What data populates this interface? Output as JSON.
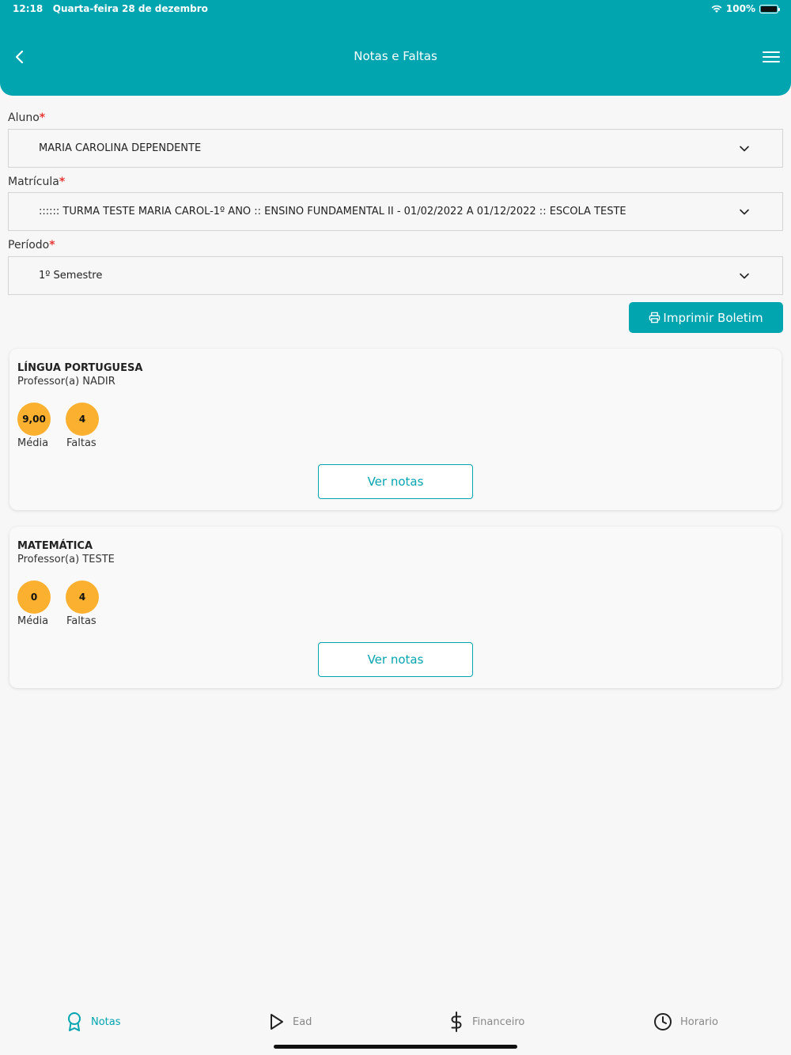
{
  "status_bar": {
    "time": "12:18",
    "date": "Quarta-feira 28 de dezembro",
    "battery": "100%"
  },
  "header": {
    "title": "Notas e Faltas"
  },
  "form": {
    "aluno": {
      "label": "Aluno",
      "required_mark": "*",
      "value": "MARIA CAROLINA DEPENDENTE"
    },
    "matricula": {
      "label": "Matrícula",
      "required_mark": "*",
      "value": ":::::: TURMA TESTE MARIA CAROL-1º ANO :: ENSINO FUNDAMENTAL II - 01/02/2022 A 01/12/2022 :: ESCOLA TESTE"
    },
    "periodo": {
      "label": "Período",
      "required_mark": "*",
      "value": "1º Semestre"
    }
  },
  "print_button": {
    "label": "Imprimir Boletim"
  },
  "subjects": [
    {
      "name": "LÍNGUA PORTUGUESA",
      "teacher": "Professor(a) NADIR",
      "media": "9,00",
      "media_label": "Média",
      "faltas": "4",
      "faltas_label": "Faltas",
      "button": "Ver notas"
    },
    {
      "name": "MATEMÁTICA",
      "teacher": "Professor(a) TESTE",
      "media": "0",
      "media_label": "Média",
      "faltas": "4",
      "faltas_label": "Faltas",
      "button": "Ver notas"
    }
  ],
  "tabs": [
    {
      "label": "Notas",
      "icon": "award-icon",
      "active": true
    },
    {
      "label": "Ead",
      "icon": "play-icon",
      "active": false
    },
    {
      "label": "Financeiro",
      "icon": "dollar-icon",
      "active": false
    },
    {
      "label": "Horario",
      "icon": "clock-icon",
      "active": false
    }
  ],
  "colors": {
    "primary": "#00a5b0",
    "badge": "#fbb030",
    "required": "#e53935"
  }
}
